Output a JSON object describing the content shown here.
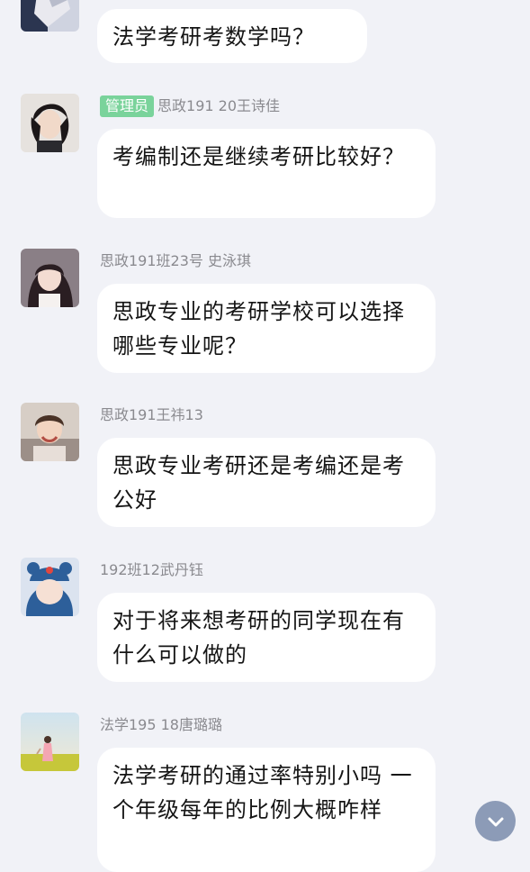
{
  "messages": [
    {
      "id": "m0",
      "sender": "",
      "badge": "",
      "text": "法学考研考数学吗？"
    },
    {
      "id": "m1",
      "sender": "思政191 20王诗佳",
      "badge": "管理员",
      "text": "考编制还是继续考研比较好？"
    },
    {
      "id": "m2",
      "sender": "思政191班23号 史泳琪",
      "badge": "",
      "text": "思政专业的考研学校可以选择哪些专业呢？"
    },
    {
      "id": "m3",
      "sender": "思政191王祎13",
      "badge": "",
      "text": "思政专业考研还是考编还是考公好"
    },
    {
      "id": "m4",
      "sender": "192班12武丹钰",
      "badge": "",
      "text": "对于将来想考研的同学现在有什么可以做的"
    },
    {
      "id": "m5",
      "sender": "法学195 18唐璐璐",
      "badge": "",
      "text": "法学考研的通过率特别小吗 一个年级每年的比例大概咋样"
    }
  ],
  "scroll_button": {
    "icon": "chevron-down-icon"
  },
  "colors": {
    "background": "#f1f2f7",
    "bubble": "#ffffff",
    "admin_badge": "#7ad39b",
    "sender_text": "#8a8a8f",
    "scroll_button": "#8c9bb7"
  }
}
